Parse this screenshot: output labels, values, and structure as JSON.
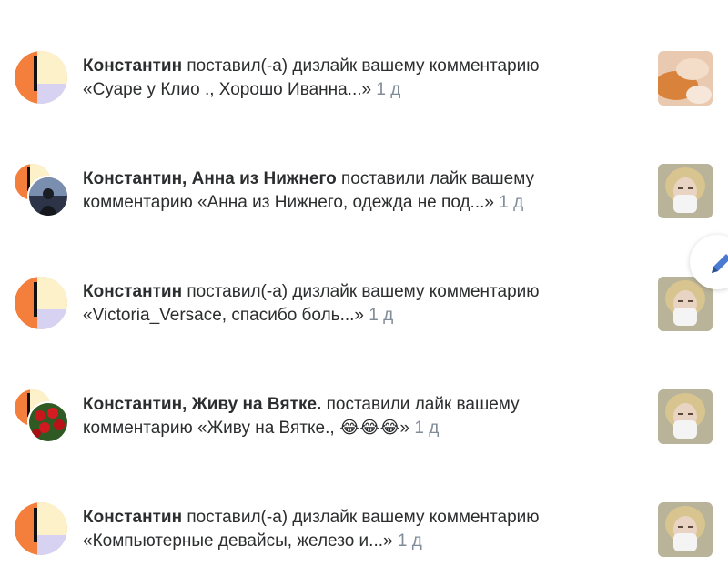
{
  "notifications": [
    {
      "names": "Константин",
      "action": " поставил(-а) дизлайк вашему комментарию",
      "quote": "«Суаре у Клио ., Хорошо Иванна...»",
      "time": "1 д",
      "thumbnail_icon": "cat-photo",
      "avatar_type": "single"
    },
    {
      "names": "Константин, Анна из Нижнего",
      "action": " поставили лайк вашему",
      "quote": "комментарию «Анна из Нижнего, одежда не под...»",
      "time": "1 д",
      "thumbnail_icon": "woman-mask-photo",
      "avatar_type": "double"
    },
    {
      "names": "Константин",
      "action": " поставил(-а) дизлайк вашему комментарию",
      "quote": "«Victoria_Versace, спасибо боль...»",
      "time": "1 д",
      "thumbnail_icon": "woman-mask-photo",
      "avatar_type": "single"
    },
    {
      "names": "Константин, Живу на Вятке.",
      "action": " поставили лайк вашему",
      "quote": "комментарию «Живу на Вятке., 😂😂😂»",
      "time": "1 д",
      "thumbnail_icon": "woman-mask-photo",
      "avatar_type": "double"
    },
    {
      "names": "Константин",
      "action": " поставил(-а) дизлайк вашему комментарию",
      "quote": "«Компьютерные девайсы, железо и...»",
      "time": "1 д",
      "thumbnail_icon": "woman-mask-photo",
      "avatar_type": "single"
    }
  ],
  "colors": {
    "text": "#2c2d2e",
    "secondary": "#818c99",
    "avatar_orange": "#f47e3b",
    "avatar_cream": "#fdf1c9",
    "avatar_lavender": "#d8d2f2"
  },
  "fab_icon": "pencil-icon"
}
